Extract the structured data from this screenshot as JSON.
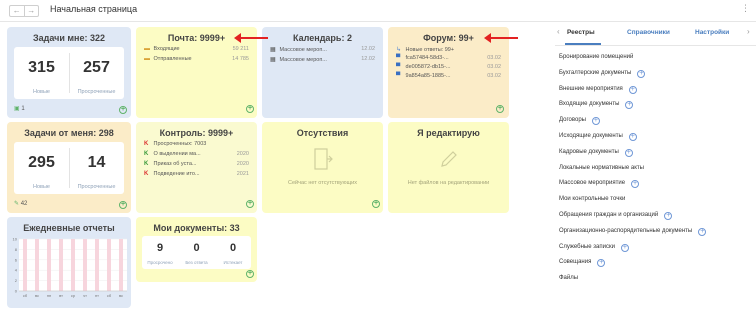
{
  "header": {
    "back": "←",
    "forward": "→",
    "title": "Начальная страница",
    "menu": "⋮"
  },
  "tasks_to_me": {
    "title": "Задачи мне: 322",
    "new_count": "315",
    "new_label": "Новые",
    "overdue_count": "257",
    "overdue_label": "Просроченные",
    "footer_count": "1"
  },
  "mail": {
    "title": "Почта: 9999+",
    "rows": [
      {
        "label": "Входящие",
        "value": "59 211"
      },
      {
        "label": "Отправленные",
        "value": "14 785"
      }
    ]
  },
  "calendar": {
    "title": "Календарь: 2",
    "rows": [
      {
        "label": "Массовое мероп...",
        "value": "12.02"
      },
      {
        "label": "Массовое мероп...",
        "value": "12.02"
      }
    ]
  },
  "forum": {
    "title": "Форум: 99+",
    "rows": [
      {
        "label": "Новые ответы: 99+",
        "value": ""
      },
      {
        "label": "fca57484-58d3-...",
        "value": "03.02"
      },
      {
        "label": "de005872-db15-...",
        "value": "03.02"
      },
      {
        "label": "9a854a85-1885-...",
        "value": "03.02"
      }
    ]
  },
  "tasks_from_me": {
    "title": "Задачи от меня: 298",
    "new_count": "295",
    "new_label": "Новые",
    "overdue_count": "14",
    "overdue_label": "Просроченные",
    "footer_count": "42"
  },
  "control": {
    "title": "Контроль: 9999+",
    "rows": [
      {
        "label": "Просроченных: 7003",
        "value": ""
      },
      {
        "label": "О выделении ма...",
        "value": "2020"
      },
      {
        "label": "Приказ об уста...",
        "value": "2020"
      },
      {
        "label": "Подведение ито...",
        "value": "2021"
      }
    ]
  },
  "absence": {
    "title": "Отсутствия",
    "empty": "Сейчас нет отсутствующих"
  },
  "editing": {
    "title": "Я редактирую",
    "empty": "Нет файлов на редактировании"
  },
  "daily_reports": {
    "title": "Ежедневные отчеты",
    "y_ticks": [
      "10",
      "8",
      "6",
      "4",
      "2",
      "0"
    ],
    "x_ticks": [
      "сб",
      "вс",
      "пн",
      "вт",
      "ср",
      "чт",
      "пт",
      "сб",
      "вс"
    ]
  },
  "chart_data": {
    "type": "bar",
    "categories": [
      "сб",
      "вс",
      "пн",
      "вт",
      "ср",
      "чт",
      "пт",
      "сб",
      "вс"
    ],
    "values": [
      0,
      0,
      0,
      0,
      0,
      0,
      0,
      0,
      0
    ],
    "title": "Ежедневные отчеты",
    "ylim": [
      0,
      10
    ]
  },
  "my_docs": {
    "title": "Мои документы: 33",
    "counters": [
      {
        "value": "9",
        "label": "Просрочено"
      },
      {
        "value": "0",
        "label": "Без ответа"
      },
      {
        "value": "0",
        "label": "Истекает"
      }
    ]
  },
  "sidebar": {
    "prev": "‹",
    "next": "›",
    "tabs": [
      "Реестры",
      "Справочники",
      "Настройки"
    ],
    "items": [
      {
        "label": "Бронирование помещений",
        "plus": false
      },
      {
        "label": "Бухгалтерские документы",
        "plus": true
      },
      {
        "label": "Внешние мероприятия",
        "plus": true
      },
      {
        "label": "Входящие документы",
        "plus": true
      },
      {
        "label": "Договоры",
        "plus": true
      },
      {
        "label": "Исходящие документы",
        "plus": true
      },
      {
        "label": "Кадровые документы",
        "plus": true
      },
      {
        "label": "Локальные нормативные акты",
        "plus": false
      },
      {
        "label": "Массовое мероприятие",
        "plus": true
      },
      {
        "label": "Мои контрольные точки",
        "plus": false
      },
      {
        "label": "Обращения граждан и организаций",
        "plus": true
      },
      {
        "label": "Организационно-распорядительные документы",
        "plus": true
      },
      {
        "label": "Служебные записки",
        "plus": true
      },
      {
        "label": "Совещания",
        "plus": true
      },
      {
        "label": "Файлы",
        "plus": false
      }
    ]
  },
  "colors": {
    "accent_blue": "#4a7ebf",
    "annotation_red": "#e32222",
    "plus_green": "#5fb36a"
  }
}
